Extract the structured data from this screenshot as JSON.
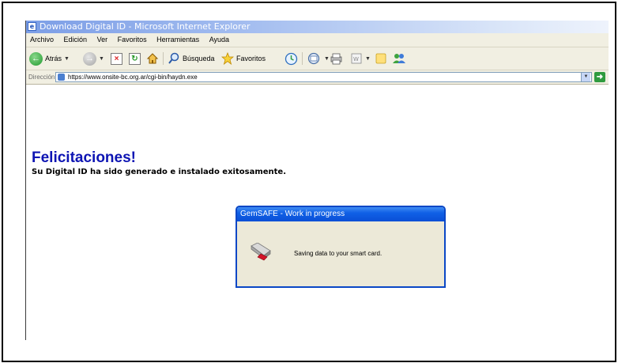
{
  "window": {
    "title": "Download Digital ID - Microsoft Internet Explorer"
  },
  "menu": [
    "Archivo",
    "Edición",
    "Ver",
    "Favoritos",
    "Herramientas",
    "Ayuda"
  ],
  "toolbar": {
    "back_label": "Atrás",
    "search_label": "Búsqueda",
    "favorites_label": "Favoritos"
  },
  "address": {
    "label": "Dirección",
    "url": "https://www.onsite-bc.org.ar/cgi-bin/haydn.exe"
  },
  "page": {
    "heading": "Felicitaciones!",
    "message": "Su Digital ID ha sido generado e instalado exitosamente."
  },
  "dialog": {
    "title": "GemSAFE - Work in progress",
    "message": "Saving data to your smart card."
  },
  "colors": {
    "heading": "#0d14b3",
    "dialog_title_bar": "#0a4fd6",
    "chrome_background": "#f1efe2"
  }
}
